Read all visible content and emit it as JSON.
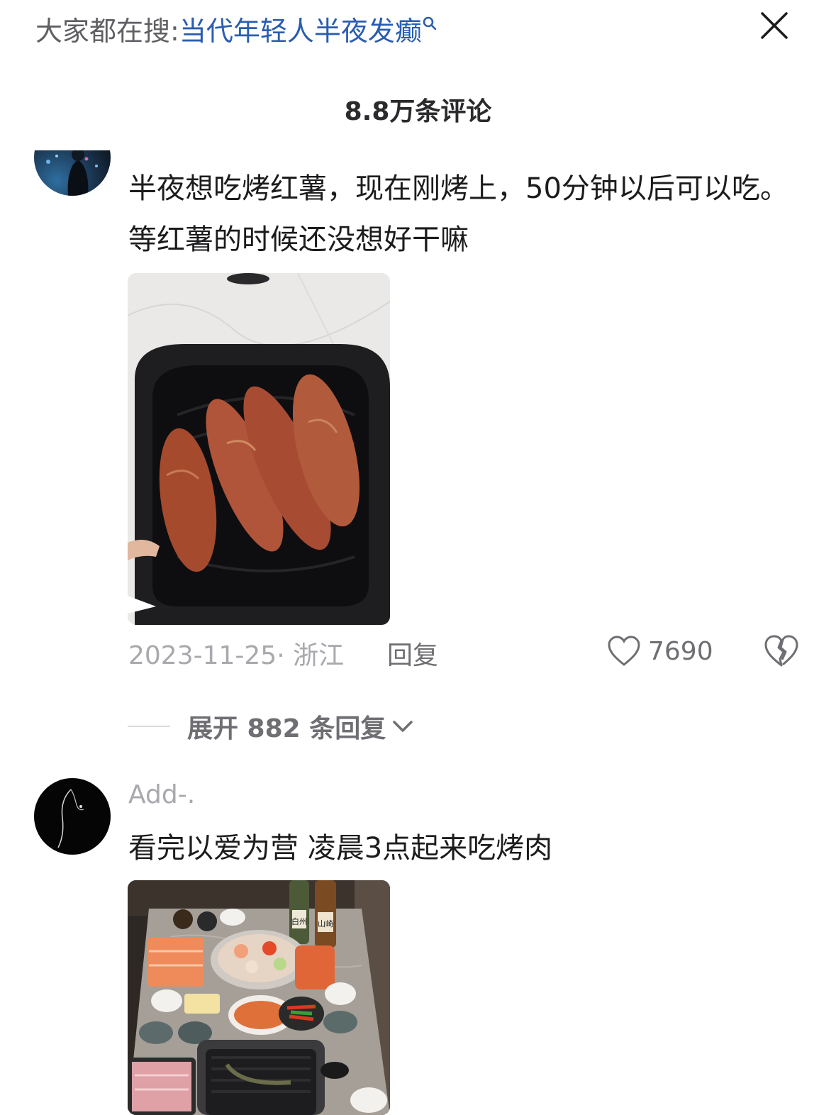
{
  "header": {
    "search_prefix": "大家都在搜:",
    "search_query": "当代年轻人半夜发癫",
    "comment_count": "8.8万条评论"
  },
  "comments": [
    {
      "text": "半夜想吃烤红薯，现在刚烤上，50分钟以后可以吃。等红薯的时候还没想好干嘛",
      "meta": "2023-11-25· 浙江",
      "reply_label": "回复",
      "likes": "7690",
      "expand_label": "展开 882 条回复"
    },
    {
      "username": "Add-.",
      "text": "看完以爱为营 凌晨3点起来吃烤肉",
      "bottle_labels": [
        "白州",
        "山崎"
      ]
    }
  ],
  "colors": {
    "link_blue": "#2a5db0",
    "meta_gray": "#a8a8ad",
    "action_gray": "#6e6e73"
  }
}
